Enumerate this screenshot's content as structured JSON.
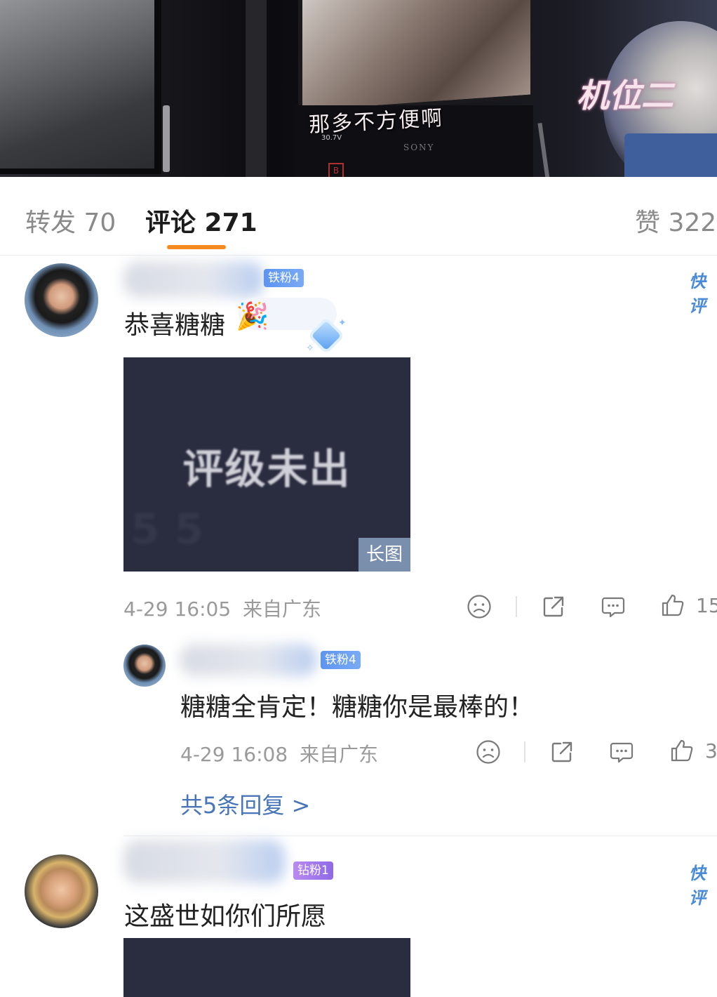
{
  "video": {
    "caption": "那多不方便啊",
    "camera_label": "机位二",
    "brand_text": "SONY",
    "voltage_text": "30.7V",
    "marker_text": "B"
  },
  "tabs": [
    {
      "label": "转发 70"
    },
    {
      "label": "评论 271",
      "active": true
    },
    {
      "label": "赞 322"
    }
  ],
  "comments": [
    {
      "badge": "铁粉4",
      "action": "快评",
      "text": "恭喜糖糖",
      "image": {
        "text": "评级未出",
        "badge": "长图"
      },
      "time": "4-29 16:05",
      "location": "来自广东",
      "likes": "15",
      "reply": {
        "badge": "铁粉4",
        "text": "糖糖全肯定！糖糖你是最棒的！",
        "time": "4-29 16:08",
        "location": "来自广东",
        "likes": "3"
      },
      "more_replies": "共5条回复 >"
    },
    {
      "badge": "钻粉1",
      "action": "快评",
      "text": "这盛世如你们所愿"
    }
  ],
  "colors": {
    "accent_underline": "#f78a1e",
    "link_blue": "#4775b8",
    "fan_badge": "#5d94f0",
    "diamond_badge": "#9a72ea"
  }
}
